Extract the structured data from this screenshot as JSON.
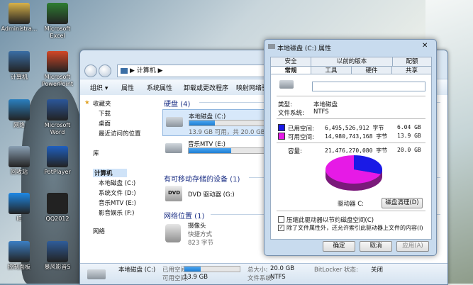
{
  "desktop_icons": [
    {
      "label": "Administra...",
      "color": "#d8b24a"
    },
    {
      "label": "Microsoft Excel",
      "color": "#2e7d32"
    },
    {
      "label": "计算机",
      "color": "#3a6ea5"
    },
    {
      "label": "Microsoft PowerPoint",
      "color": "#d24726"
    },
    {
      "label": "网络",
      "color": "#2a7fbf"
    },
    {
      "label": "Microsoft Word",
      "color": "#2b579a"
    },
    {
      "label": "回收站",
      "color": "#8aa0b4"
    },
    {
      "label": "PotPlayer",
      "color": "#1f5fbf"
    },
    {
      "label": "IE",
      "color": "#1e88e5"
    },
    {
      "label": "QQ2012",
      "color": "#222222"
    },
    {
      "label": "控制面板",
      "color": "#3b7fc4"
    },
    {
      "label": "暴风影音5",
      "color": "#2f5d9a"
    }
  ],
  "explorer": {
    "breadcrumb": "▶ 计算机 ▶",
    "toolbar": [
      "组织 ▾",
      "属性",
      "系统属性",
      "卸载或更改程序",
      "映射网络驱"
    ],
    "nav": {
      "favorites": "收藏夹",
      "favorites_items": [
        "下载",
        "桌面",
        "最近访问的位置"
      ],
      "library": "库",
      "computer": "计算机",
      "computer_items": [
        "本地磁盘 (C:)",
        "系统文件 (D:)",
        "音乐MTV (E:)",
        "影音娱乐 (F:)"
      ],
      "network": "网络"
    },
    "sections": {
      "hdd": "硬盘 (4)",
      "removable": "有可移动存储的设备 (1)",
      "network": "网络位置 (1)"
    },
    "drives": [
      {
        "name": "本地磁盘 (C:)",
        "free": "13.9 GB 可用，共 20.0 GB",
        "used_fraction": 0.3
      },
      {
        "name": "音乐MTV (E:)",
        "free": "",
        "used_fraction": 0.5
      }
    ],
    "dvd": {
      "name": "DVD 驱动器 (G:)",
      "label": "DVD"
    },
    "camera": {
      "name": "摄像头",
      "type": "快捷方式",
      "size": "823 字节"
    },
    "details": {
      "name": "本地磁盘 (C:)",
      "used_label": "已用空间:",
      "free_label": "可用空间:",
      "free_value": "13.9 GB",
      "total_label": "总大小:",
      "total_value": "20.0 GB",
      "fs_label": "文件系统:",
      "fs_value": "NTFS",
      "bitlocker_label": "BitLocker 状态:",
      "bitlocker_value": "关闭",
      "used_fraction": 0.3
    }
  },
  "dialog": {
    "title": "本地磁盘 (C:) 属性",
    "tabs_row1": [
      "安全",
      "以前的版本",
      "配额"
    ],
    "tabs_row2": [
      "常规",
      "工具",
      "硬件",
      "共享"
    ],
    "type_label": "类型:",
    "type_value": "本地磁盘",
    "fs_label": "文件系统:",
    "fs_value": "NTFS",
    "used_label": "已用空间:",
    "used_bytes": "6,495,526,912 字节",
    "used_gb": "6.04 GB",
    "free_label": "可用空间:",
    "free_bytes": "14,980,743,168 字节",
    "free_gb": "13.9 GB",
    "cap_label": "容量:",
    "cap_bytes": "21,476,270,080 字节",
    "cap_gb": "20.0 GB",
    "drive_label": "驱动器 C:",
    "cleanup_button": "磁盘清理(D)",
    "compress_label": "压缩此驱动器以节约磁盘空间(C)",
    "index_label": "除了文件属性外，还允许索引此驱动器上文件的内容(I)",
    "index_checked": "✓",
    "ok": "确定",
    "cancel": "取消",
    "apply": "应用(A)",
    "used_color": "#1a1ae6",
    "free_color": "#e61ae6",
    "used_fraction": 0.3025
  }
}
